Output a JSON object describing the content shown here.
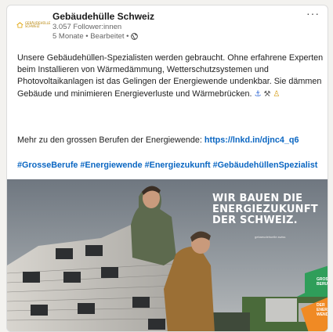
{
  "post": {
    "author_name": "Gebäudehülle Schweiz",
    "followers": "3.057 Follower:innen",
    "meta": "5 Monate • Bearbeitet •",
    "logo_text": "GEBÄUDEHÜLLE SCHWEIZ",
    "more_label": "···",
    "body_text": "Unsere Gebäudehüllen-Spezialisten werden gebraucht. Ohne erfahrene Experten beim Installieren von Wärmedämmung, Wetterschutzsystemen und Photovoltaikanlagen ist das Gelingen der Energiewende undenkbar. Sie dämmen Gebäude und minimieren Energieverluste und Wärmebrücken.",
    "emojis": [
      "⚓",
      "⚒",
      "♙"
    ],
    "more_prefix": "Mehr zu den grossen Berufen der Energiewende:",
    "link": "https://lnkd.in/djnc4_q6",
    "hashtags": "#GrosseBerufe #Energiewende #Energiezukunft #GebäudehüllenSpezialist"
  },
  "image": {
    "headline_line1": "WIR BAUEN DIE",
    "headline_line2": "ENERGIEZUKUNFT",
    "headline_line3": "DER SCHWEIZ.",
    "headline_url": "gebaeudehuelle.swiss",
    "tag1": "GROSSE BERUFE",
    "tag2": "DER ENERGIE WENDE"
  },
  "colors": {
    "link": "#0a66c2",
    "accent_green": "#2f9e5a",
    "accent_orange": "#f08a24"
  }
}
